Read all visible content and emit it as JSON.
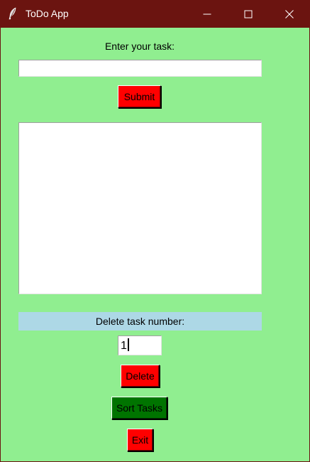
{
  "window": {
    "title": "ToDo App",
    "icon": "feather-icon",
    "titlebar_color": "#6b1410",
    "background_color": "#90ee90"
  },
  "controls": {
    "minimize_icon": "minimize-icon",
    "maximize_icon": "maximize-icon",
    "close_icon": "close-icon"
  },
  "task_form": {
    "prompt": "Enter your task:",
    "input_value": "",
    "submit_label": "Submit"
  },
  "task_list": {
    "items": []
  },
  "delete_form": {
    "prompt": "Delete task number:",
    "prompt_bg": "#add8e6",
    "number_value": "1",
    "delete_label": "Delete"
  },
  "actions": {
    "sort_label": "Sort Tasks",
    "exit_label": "Exit",
    "red_button_color": "#ff0000",
    "green_button_color": "#007400"
  }
}
